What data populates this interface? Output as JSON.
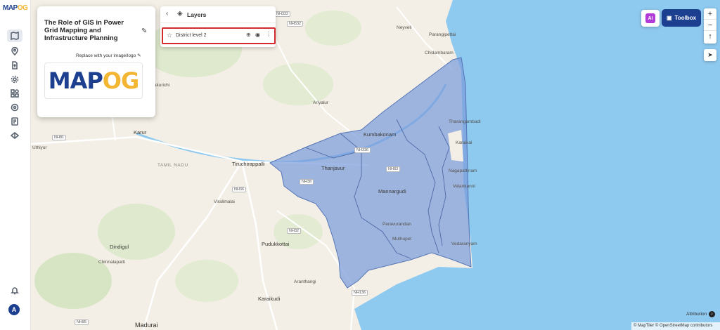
{
  "app": {
    "logo_main": "MAP",
    "logo_accent": "OG"
  },
  "project": {
    "title": "The Role of GIS in Power Grid Mapping and Infrastructure Planning",
    "replace_label": "Replace with your image/logo",
    "logo_main": "MAP",
    "logo_accent": "OG"
  },
  "layers": {
    "title": "Layers",
    "items": [
      {
        "name": "District level 2"
      }
    ]
  },
  "toolbar": {
    "ai_label": "AI",
    "toolbox_label": "Toolbox",
    "zoom_in": "+",
    "zoom_out": "−",
    "compass": "↑",
    "locate": "➤"
  },
  "map": {
    "attribution_label": "Attribution",
    "attribution_text": "© MapTiler © OpenStreetMap contributors",
    "labels": {
      "thanjavur": "Thanjavur",
      "kumbakonam": "Kumbakonam",
      "tiruchirappalli": "Tiruchirappalli",
      "karur": "Karur",
      "tamil_nadu": "TAMIL NADU",
      "mannargudi": "Mannargudi",
      "pudukkottai": "Pudukkottai",
      "dindigul": "Dindigul",
      "madurai": "Madurai",
      "karaikudi": "Karaikudi",
      "ariyalur": "Ariyalur",
      "chidambaram": "Chidambaram",
      "tharangambadi": "Tharangambadi",
      "karaikal": "Karaikal",
      "nagapattinam": "Nagapattinam",
      "velankanni": "Velankanni",
      "vedaranyam": "Vedaranyam",
      "muthupet": "Muthupet",
      "peravurani": "Peravurandan",
      "viralimalai": "Viralimalai",
      "chinnalapatti": "Chinnalapatti",
      "aranthangi": "Aranthangi",
      "uthiyur": "Uthiyur",
      "neyveli": "Neyveli",
      "parangipettai": "Parangipettai",
      "kallakurichi": "Kallakurichi"
    },
    "roads": [
      "NH81",
      "NH38",
      "NH36",
      "NH83",
      "NH336",
      "NH85",
      "NH32",
      "NH332",
      "NH532",
      "NH136"
    ]
  },
  "colors": {
    "brand": "#1d3f8f",
    "accent": "#f2b632",
    "district_fill": "#7b9cdc",
    "sea": "#8ec9ef",
    "highlight": "#d52b2b"
  }
}
